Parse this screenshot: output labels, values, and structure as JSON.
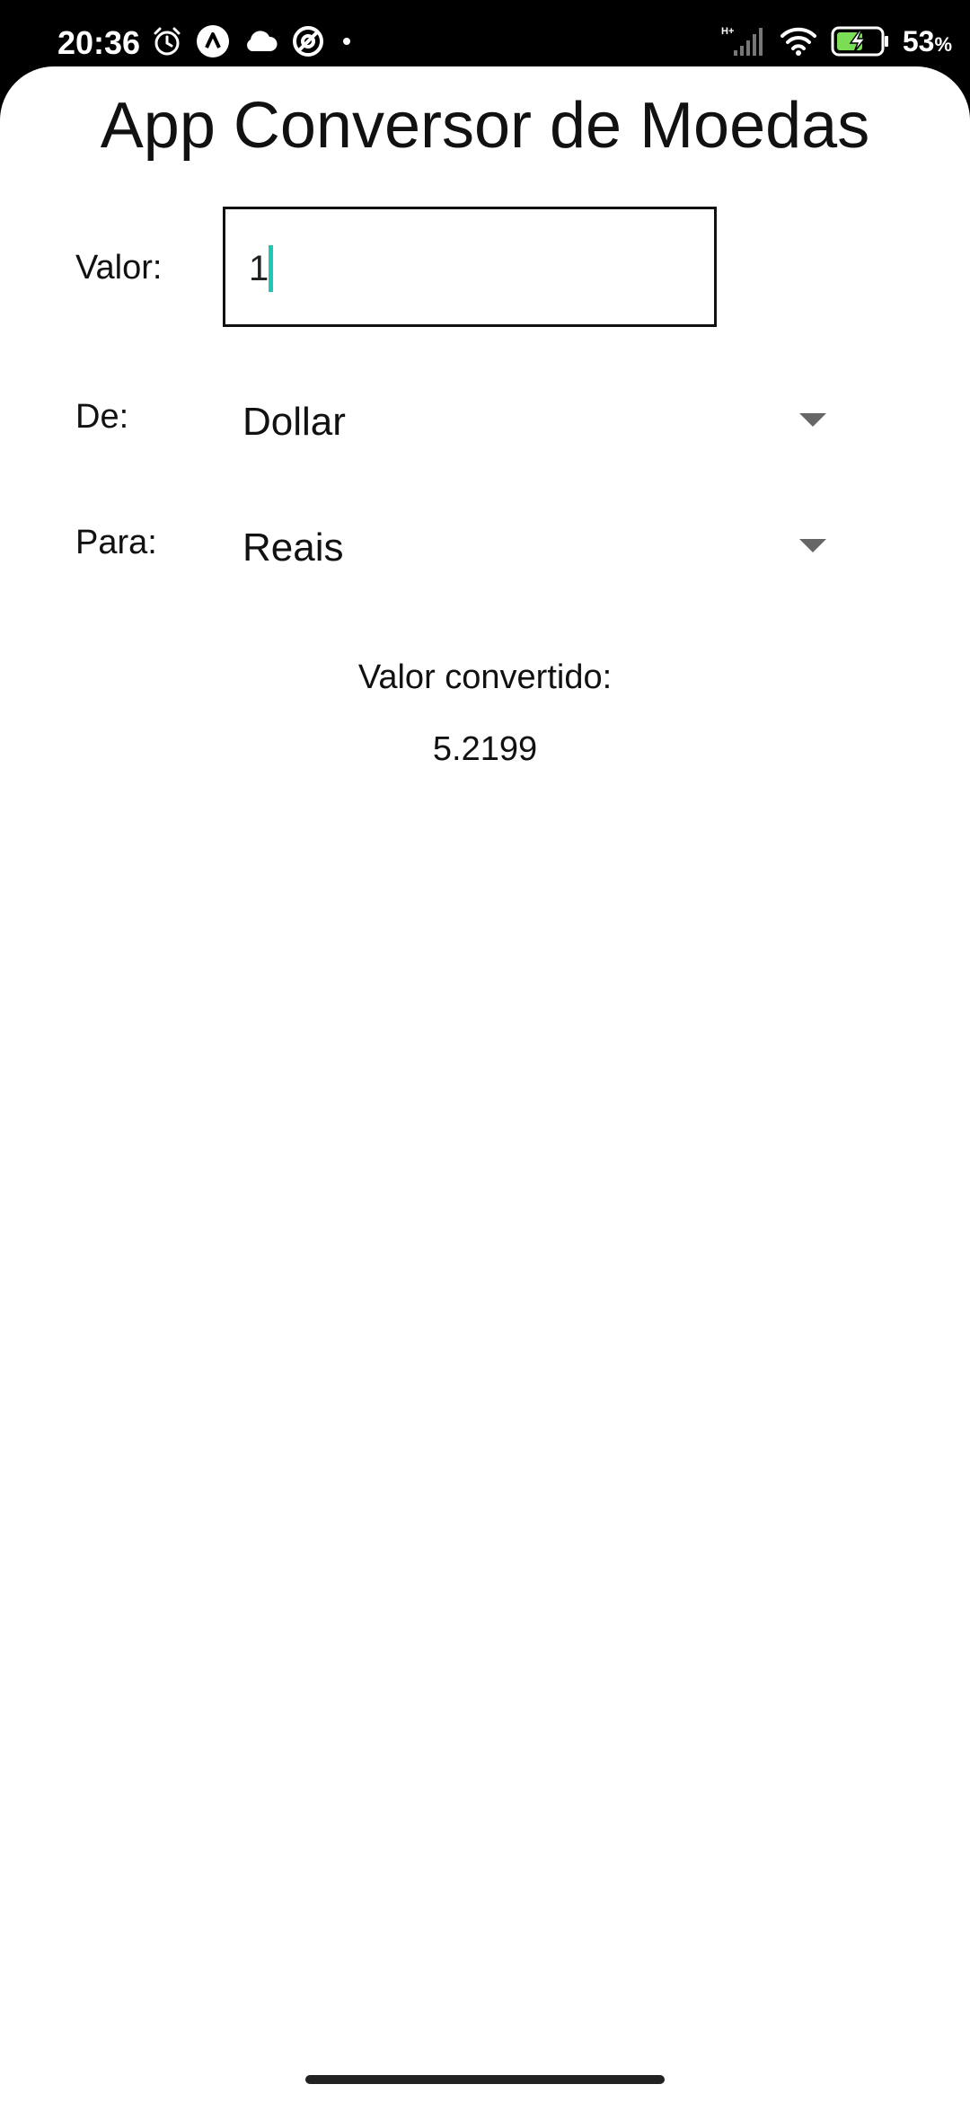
{
  "status_bar": {
    "time": "20:36",
    "battery_level": "53",
    "battery_unit": "%",
    "icons": [
      "alarm-icon",
      "app-notification-icon",
      "cloud-icon",
      "vpn-icon",
      "dot-icon",
      "hplus-signal-icon",
      "wifi-icon",
      "battery-charging-icon"
    ]
  },
  "app": {
    "title": "App Conversor de Moedas",
    "amount": {
      "label": "Valor:",
      "value": "1"
    },
    "from": {
      "label": "De:",
      "selected": "Dollar"
    },
    "to": {
      "label": "Para:",
      "selected": "Reais"
    },
    "result": {
      "label": "Valor convertido:",
      "value": "5.2199"
    }
  },
  "colors": {
    "caret": "#1fc8b4",
    "background": "#ffffff",
    "status_bar": "#000000"
  }
}
